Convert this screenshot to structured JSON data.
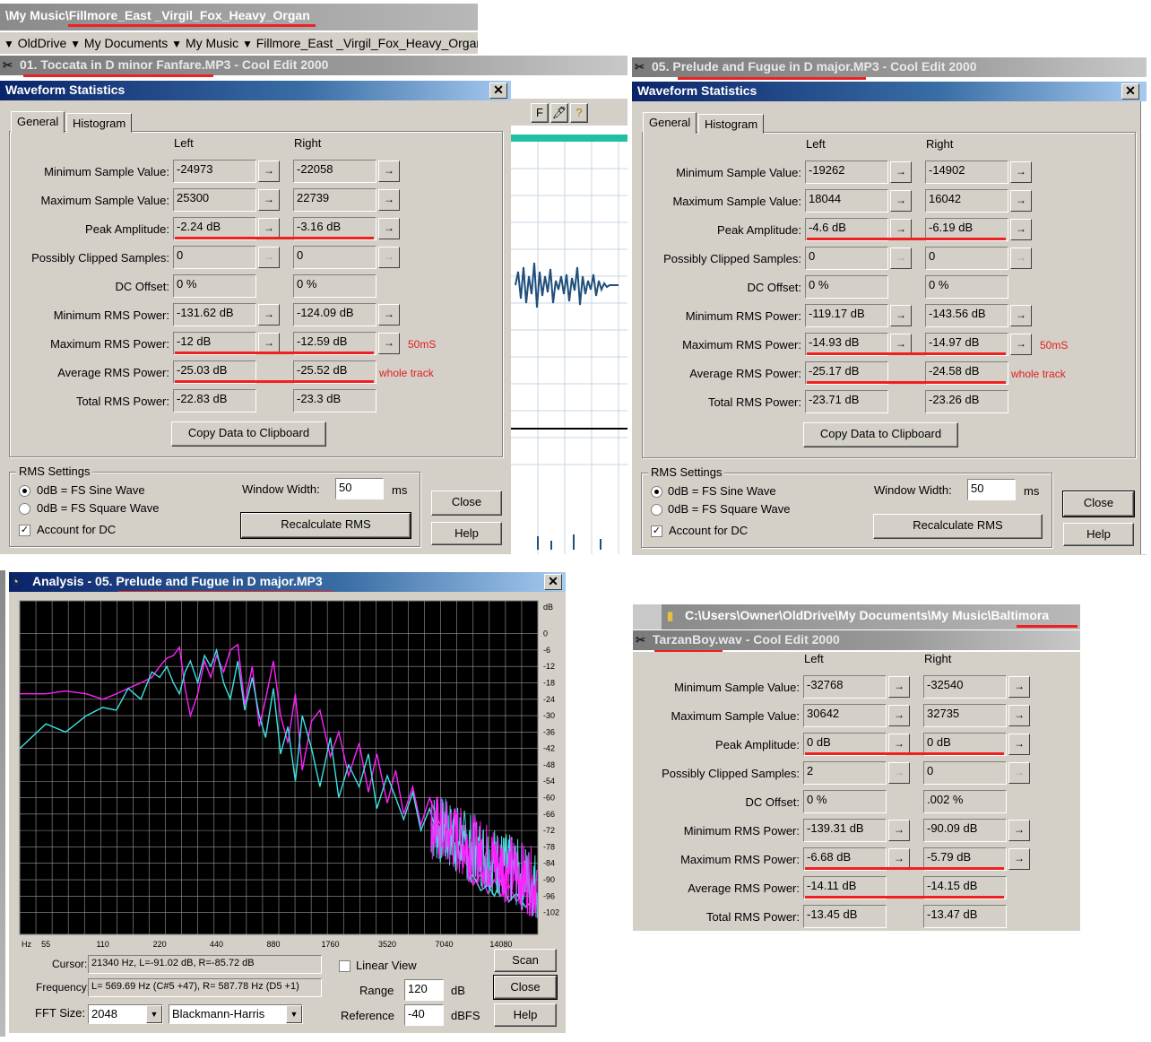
{
  "top_path": {
    "prefix": "\\My Music\\",
    "folder": "Fillmore_East _Virgil_Fox_Heavy_Organ",
    "crumbs": [
      "OldDrive",
      "My Documents",
      "My Music",
      "Fillmore_East _Virgil_Fox_Heavy_Organ"
    ]
  },
  "win1": {
    "app_title_name": "01. Toccata in D minor  Fanfare.MP3",
    "app_title_suffix": " - Cool Edit 2000",
    "dialog_title": "Waveform Statistics",
    "close_x": "✕",
    "tabs": [
      "General",
      "Histogram"
    ],
    "col_left": "Left",
    "col_right": "Right",
    "rows": [
      {
        "label": "Minimum Sample Value:",
        "left": "-24973",
        "right": "-22058",
        "arrow": true
      },
      {
        "label": "Maximum Sample Value:",
        "left": "25300",
        "right": "22739",
        "arrow": true
      },
      {
        "label": "Peak Amplitude:",
        "left": "-2.24 dB",
        "right": "-3.16 dB",
        "arrow": true
      },
      {
        "label": "Possibly Clipped Samples:",
        "left": "0",
        "right": "0",
        "arrow": "disabled"
      },
      {
        "label": "DC Offset:",
        "left": "0 %",
        "right": "0 %",
        "arrow": false
      },
      {
        "label": "Minimum RMS Power:",
        "left": "-131.62 dB",
        "right": "-124.09 dB",
        "arrow": true
      },
      {
        "label": "Maximum RMS Power:",
        "left": "-12 dB",
        "right": "-12.59 dB",
        "arrow": true
      },
      {
        "label": "Average RMS Power:",
        "left": "-25.03 dB",
        "right": "-25.52 dB",
        "arrow": false
      },
      {
        "label": "Total RMS Power:",
        "left": "-22.83 dB",
        "right": "-23.3 dB",
        "arrow": false
      }
    ],
    "note_50": "50mS",
    "note_whole": "whole track",
    "copy_btn": "Copy Data to Clipboard",
    "rms_group": "RMS Settings",
    "radio_sine": "0dB = FS Sine Wave",
    "radio_square": "0dB = FS Square Wave",
    "account_dc": "Account for DC",
    "window_width_label": "Window Width:",
    "window_width_value": "50",
    "ms": "ms",
    "recalc_btn": "Recalculate RMS",
    "close_btn": "Close",
    "help_btn": "Help",
    "toolbar_f": "F"
  },
  "win2": {
    "app_title_name": "05. Prelude and Fugue in D major.MP3",
    "app_title_suffix": " - Cool Edit 2000",
    "dialog_title": "Waveform Statistics",
    "tabs": [
      "General",
      "Histogram"
    ],
    "col_left": "Left",
    "col_right": "Right",
    "rows": [
      {
        "label": "Minimum Sample Value:",
        "left": "-19262",
        "right": "-14902",
        "arrow": true
      },
      {
        "label": "Maximum Sample Value:",
        "left": "18044",
        "right": "16042",
        "arrow": true
      },
      {
        "label": "Peak Amplitude:",
        "left": "-4.6 dB",
        "right": "-6.19 dB",
        "arrow": true
      },
      {
        "label": "Possibly Clipped Samples:",
        "left": "0",
        "right": "0",
        "arrow": "disabled"
      },
      {
        "label": "DC Offset:",
        "left": "0 %",
        "right": "0 %",
        "arrow": false
      },
      {
        "label": "Minimum RMS Power:",
        "left": "-119.17 dB",
        "right": "-143.56 dB",
        "arrow": true
      },
      {
        "label": "Maximum RMS Power:",
        "left": "-14.93 dB",
        "right": "-14.97 dB",
        "arrow": true
      },
      {
        "label": "Average RMS Power:",
        "left": "-25.17 dB",
        "right": "-24.58 dB",
        "arrow": false
      },
      {
        "label": "Total RMS Power:",
        "left": "-23.71 dB",
        "right": "-23.26 dB",
        "arrow": false
      }
    ],
    "note_50": "50mS",
    "note_whole": "whole track",
    "copy_btn": "Copy Data to Clipboard",
    "rms_group": "RMS Settings",
    "radio_sine": "0dB = FS Sine Wave",
    "radio_square": "0dB = FS Square Wave",
    "account_dc": "Account for DC",
    "window_width_label": "Window Width:",
    "window_width_value": "50",
    "ms": "ms",
    "recalc_btn": "Recalculate RMS",
    "close_btn": "Close",
    "help_btn": "Help"
  },
  "analysis": {
    "title_prefix": "Analysis - 05. ",
    "title_name": "Prelude and Fugue in D major.MP3",
    "cursor_label": "Cursor:",
    "cursor_value": "21340 Hz, L=-91.02 dB, R=-85.72 dB",
    "frequency_label": "Frequency:",
    "frequency_value": "L= 569.69 Hz (C#5 +47), R= 587.78 Hz (D5 +1)",
    "fft_label": "FFT Size:",
    "fft_value": "2048",
    "window_value": "Blackmann-Harris",
    "linear_view": "Linear View",
    "range_label": "Range",
    "range_value": "120",
    "range_unit": "dB",
    "reference_label": "Reference",
    "reference_value": "-40",
    "reference_unit": "dBFS",
    "scan_btn": "Scan",
    "close_btn": "Close",
    "help_btn": "Help"
  },
  "chart_data": {
    "type": "line",
    "x_scale": "log",
    "x_unit": "Hz",
    "x_ticks": [
      "55",
      "110",
      "220",
      "440",
      "880",
      "1760",
      "3520",
      "7040",
      "14080"
    ],
    "x_tick_values": [
      55,
      110,
      220,
      440,
      880,
      1760,
      3520,
      7040,
      14080
    ],
    "y_unit": "dB",
    "y_ticks": [
      "0",
      "-6",
      "-12",
      "-18",
      "-24",
      "-30",
      "-36",
      "-42",
      "-48",
      "-54",
      "-60",
      "-66",
      "-72",
      "-78",
      "-84",
      "-90",
      "-96",
      "-102"
    ],
    "y_range": [
      -110,
      12
    ],
    "grid": true,
    "colors": {
      "left": "#ff20ff",
      "right": "#40e0e0",
      "grid": "#9a9a9a",
      "bg": "#000000"
    },
    "series": [
      {
        "x": [
          40,
          55,
          70,
          90,
          110,
          130,
          150,
          175,
          200,
          220,
          240,
          260,
          280,
          300,
          320,
          350,
          380,
          410,
          440,
          480,
          520,
          570,
          620,
          680,
          740,
          800,
          880,
          960,
          1050,
          1150,
          1250,
          1400,
          1550,
          1760,
          1950,
          2200,
          2500,
          2800,
          3100,
          3520,
          3900,
          4300,
          4800,
          5300,
          5900,
          6500,
          7040,
          7600,
          8000,
          8500,
          9000,
          9500,
          10000,
          11000,
          12000,
          13000,
          14080,
          15500,
          17000,
          19000,
          21000
        ],
        "values": [
          -22,
          -22,
          -21,
          -22,
          -24,
          -22,
          -20,
          -18,
          -16,
          -12,
          -9,
          -8,
          -5,
          -20,
          -30,
          -22,
          -10,
          -16,
          -8,
          -14,
          -6,
          -4,
          -26,
          -12,
          -34,
          -24,
          -10,
          -30,
          -40,
          -22,
          -50,
          -32,
          -28,
          -45,
          -36,
          -52,
          -40,
          -58,
          -44,
          -62,
          -50,
          -66,
          -56,
          -70,
          -60,
          -68,
          -72,
          -76,
          -64,
          -82,
          -70,
          -86,
          -92,
          -88,
          -95,
          -90,
          -96,
          -92,
          -98,
          -94,
          -96
        ]
      },
      {
        "x": [
          40,
          55,
          70,
          90,
          110,
          130,
          150,
          175,
          200,
          220,
          240,
          260,
          280,
          300,
          320,
          350,
          380,
          410,
          440,
          480,
          520,
          570,
          620,
          680,
          740,
          800,
          880,
          960,
          1050,
          1150,
          1250,
          1400,
          1550,
          1760,
          1950,
          2200,
          2500,
          2800,
          3100,
          3520,
          3900,
          4300,
          4800,
          5300,
          5900,
          6500,
          7040,
          7600,
          8000,
          8500,
          9000,
          9500,
          10000,
          11000,
          12000,
          13000,
          14080,
          15500,
          17000,
          19000,
          21000
        ],
        "values": [
          -42,
          -33,
          -36,
          -30,
          -27,
          -28,
          -20,
          -24,
          -14,
          -16,
          -12,
          -18,
          -22,
          -14,
          -10,
          -18,
          -8,
          -12,
          -6,
          -18,
          -24,
          -10,
          -28,
          -16,
          -30,
          -38,
          -20,
          -44,
          -34,
          -54,
          -30,
          -42,
          -56,
          -38,
          -60,
          -48,
          -56,
          -44,
          -64,
          -52,
          -60,
          -68,
          -58,
          -72,
          -64,
          -74,
          -70,
          -78,
          -66,
          -84,
          -72,
          -90,
          -88,
          -94,
          -92,
          -96,
          -90,
          -98,
          -95,
          -100,
          -97
        ]
      }
    ]
  },
  "win3": {
    "path_drive": "C:\\Users\\Owner\\OldDrive\\My Documents\\My Music\\",
    "path_folder": "Baltimora",
    "app_title_name": "TarzanBoy.wav",
    "app_title_suffix": " - Cool Edit 2000",
    "col_left": "Left",
    "col_right": "Right",
    "rows": [
      {
        "label": "Minimum Sample Value:",
        "left": "-32768",
        "right": "-32540",
        "arrow": true
      },
      {
        "label": "Maximum Sample Value:",
        "left": "30642",
        "right": "32735",
        "arrow": true
      },
      {
        "label": "Peak Amplitude:",
        "left": "0 dB",
        "right": "0 dB",
        "arrow": true
      },
      {
        "label": "Possibly Clipped Samples:",
        "left": "2",
        "right": "0",
        "arrow": "disabled"
      },
      {
        "label": "DC Offset:",
        "left": "0 %",
        "right": ".002 %",
        "arrow": false
      },
      {
        "label": "Minimum RMS Power:",
        "left": "-139.31 dB",
        "right": "-90.09 dB",
        "arrow": true
      },
      {
        "label": "Maximum RMS Power:",
        "left": "-6.68 dB",
        "right": "-5.79 dB",
        "arrow": true
      },
      {
        "label": "Average RMS Power:",
        "left": "-14.11 dB",
        "right": "-14.15 dB",
        "arrow": false
      },
      {
        "label": "Total RMS Power:",
        "left": "-13.45 dB",
        "right": "-13.47 dB",
        "arrow": false
      }
    ]
  },
  "icons": {
    "arrow": "→",
    "dropdown": "▼",
    "close": "✕"
  }
}
